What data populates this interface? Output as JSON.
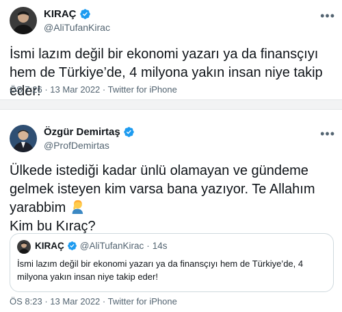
{
  "tweet1": {
    "display_name": "KIRAÇ",
    "handle": "@AliTufanKirac",
    "text": "İsmi lazım değil bir ekonomi yazarı ya da finansçıyı hem de Türkiye’de, 4 milyona yakın insan niye takip eder!",
    "time": "ÖS 7:26",
    "date": "13 Mar 2022",
    "source": "Twitter for iPhone",
    "more_icon": "more-icon"
  },
  "tweet2": {
    "display_name": "Özgür Demirtaş",
    "handle": "@ProfDemirtas",
    "text_line1": "Ülkede istediği kadar ünlü olamayan ve gündeme",
    "text_line2": "gelmek isteyen kim varsa bana yazıyor. Te Allahım",
    "text_line3": "yarabbim",
    "text_line4": "Kim bu Kıraç?",
    "emoji": "person-facepalming-emoji",
    "time": "ÖS 8:23",
    "date": "13 Mar 2022",
    "source": "Twitter for iPhone",
    "more_icon": "more-icon"
  },
  "quoted": {
    "display_name": "KIRAÇ",
    "handle": "@AliTufanKirac",
    "time_ago": "14s",
    "text": "İsmi lazım değil bir ekonomi yazarı ya da finansçıyı hem de Türkiye’de, 4 milyona yakın insan niye takip eder!"
  },
  "meta_sep": "·",
  "colors": {
    "verified": "#1d9bf0",
    "secondary_text": "#536471",
    "primary_text": "#0f1419",
    "border": "#cfd9de"
  }
}
